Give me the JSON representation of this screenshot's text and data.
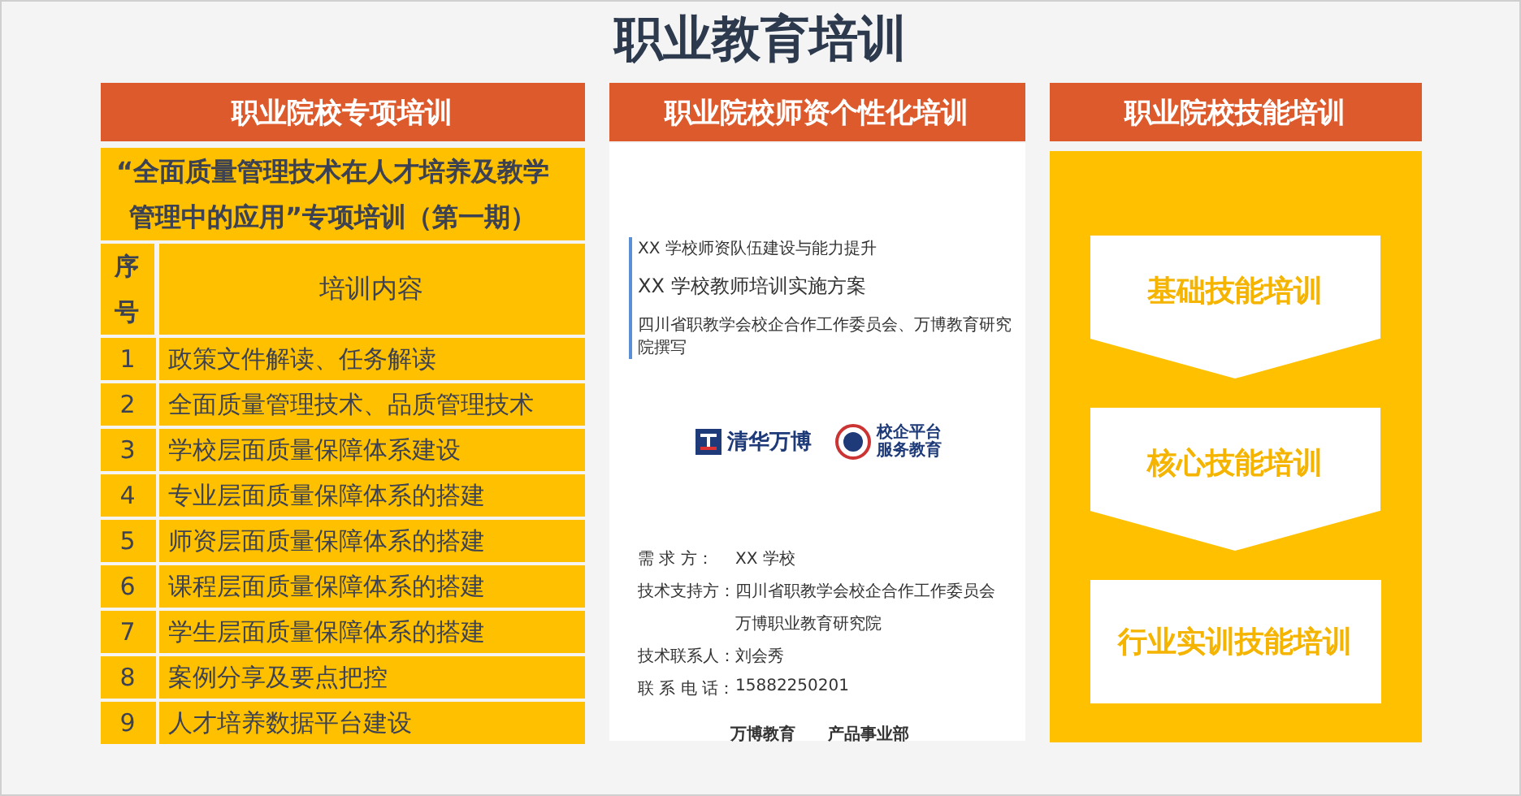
{
  "title": "职业教育培训",
  "left": {
    "header": "职业院校专项培训",
    "subtitle": "“全面质量管理技术在人才培养及教学管理中的应用”专项培训（第一期）",
    "table": {
      "columns": [
        "序号",
        "培训内容"
      ],
      "rows": [
        [
          "1",
          "政策文件解读、任务解读"
        ],
        [
          "2",
          "全面质量管理技术、品质管理技术"
        ],
        [
          "3",
          "学校层面质量保障体系建设"
        ],
        [
          "4",
          "专业层面质量保障体系的搭建"
        ],
        [
          "5",
          "师资层面质量保障体系的搭建"
        ],
        [
          "6",
          "课程层面质量保障体系的搭建"
        ],
        [
          "7",
          "学生层面质量保障体系的搭建"
        ],
        [
          "8",
          "案例分享及要点把控"
        ],
        [
          "9",
          "人才培养数据平台建设"
        ]
      ]
    }
  },
  "middle": {
    "header": "职业院校师资个性化培训",
    "document": {
      "series": "XX 学校师资队伍建设与能力提升",
      "title": "XX 学校教师培训实施方案",
      "author": "四川省职教学会校企合作工作委员会、万博教育研究院撰写",
      "logos": [
        {
          "kind": "brand",
          "text": "清华万博"
        },
        {
          "kind": "seal",
          "text": "校企平台服务教育"
        }
      ],
      "info": [
        {
          "label": "需 求 方：",
          "values": [
            "XX 学校"
          ]
        },
        {
          "label": "技术支持方：",
          "values": [
            "四川省职教学会校企合作工作委员会",
            "万博职业教育研究院"
          ]
        },
        {
          "label": "技术联系人：",
          "values": [
            "刘会秀"
          ]
        },
        {
          "label": "联 系 电 话：",
          "values": [
            "15882250201"
          ]
        }
      ],
      "footer": [
        "万博教育",
        "产品事业部"
      ]
    }
  },
  "right": {
    "header": "职业院校技能培训",
    "steps": [
      {
        "kind": "arrow",
        "label": "基础技能培训"
      },
      {
        "kind": "arrow",
        "label": "核心技能培训"
      },
      {
        "kind": "box",
        "label": "行业实训技能培训"
      }
    ]
  }
}
